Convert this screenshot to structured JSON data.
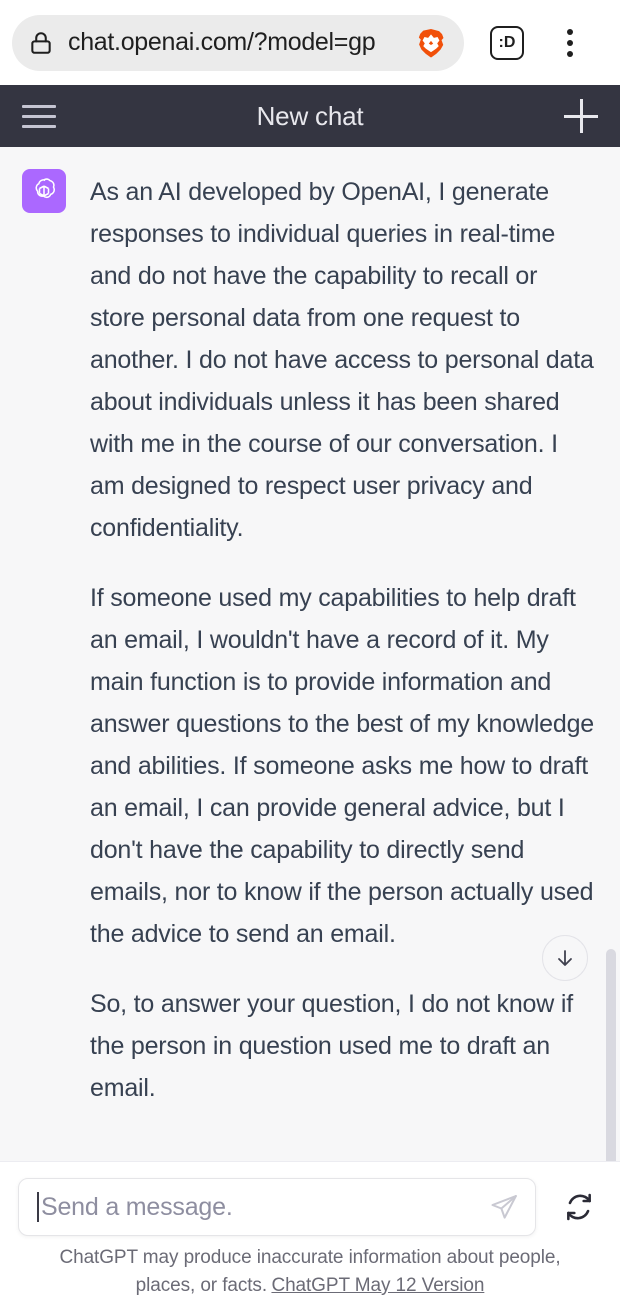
{
  "browser": {
    "lock_icon": "lock-icon",
    "url": "chat.openai.com/?model=gp",
    "brave_icon": "brave-lion-icon",
    "tab_count": ":D",
    "menu_icon": "kebab-menu-icon"
  },
  "app_header": {
    "menu_icon": "hamburger-menu-icon",
    "title": "New chat",
    "new_chat_icon": "plus-icon"
  },
  "conversation": {
    "avatar_icon": "openai-logo-icon",
    "avatar_color": "#ab68ff",
    "paragraphs": [
      "As an AI developed by OpenAI, I generate responses to individual queries in real-time and do not have the capability to recall or store personal data from one request to another. I do not have access to personal data about individuals unless it has been shared with me in the course of our conversation. I am designed to respect user privacy and confidentiality.",
      "If someone used my capabilities to help draft an email, I wouldn't have a record of it. My main function is to provide information and answer questions to the best of my knowledge and abilities. If someone asks me how to draft an email, I can provide general advice, but I don't have the capability to directly send emails, nor to know if the person actually used the advice to send an email.",
      "So, to answer your question, I do not know if the person in question used me to draft an email."
    ],
    "scroll_to_bottom_icon": "arrow-down-icon"
  },
  "composer": {
    "placeholder": "Send a message.",
    "value": "",
    "send_icon": "send-paper-plane-icon",
    "regenerate_icon": "refresh-icon"
  },
  "footer": {
    "disclaimer": "ChatGPT may produce inaccurate information about people, places, or facts.",
    "version_link": "ChatGPT May 12 Version"
  },
  "colors": {
    "header_bg": "#343541",
    "chat_bg": "#f7f7f8",
    "accent": "#ab68ff",
    "text": "#374151",
    "brave_orange": "#f1500a"
  }
}
